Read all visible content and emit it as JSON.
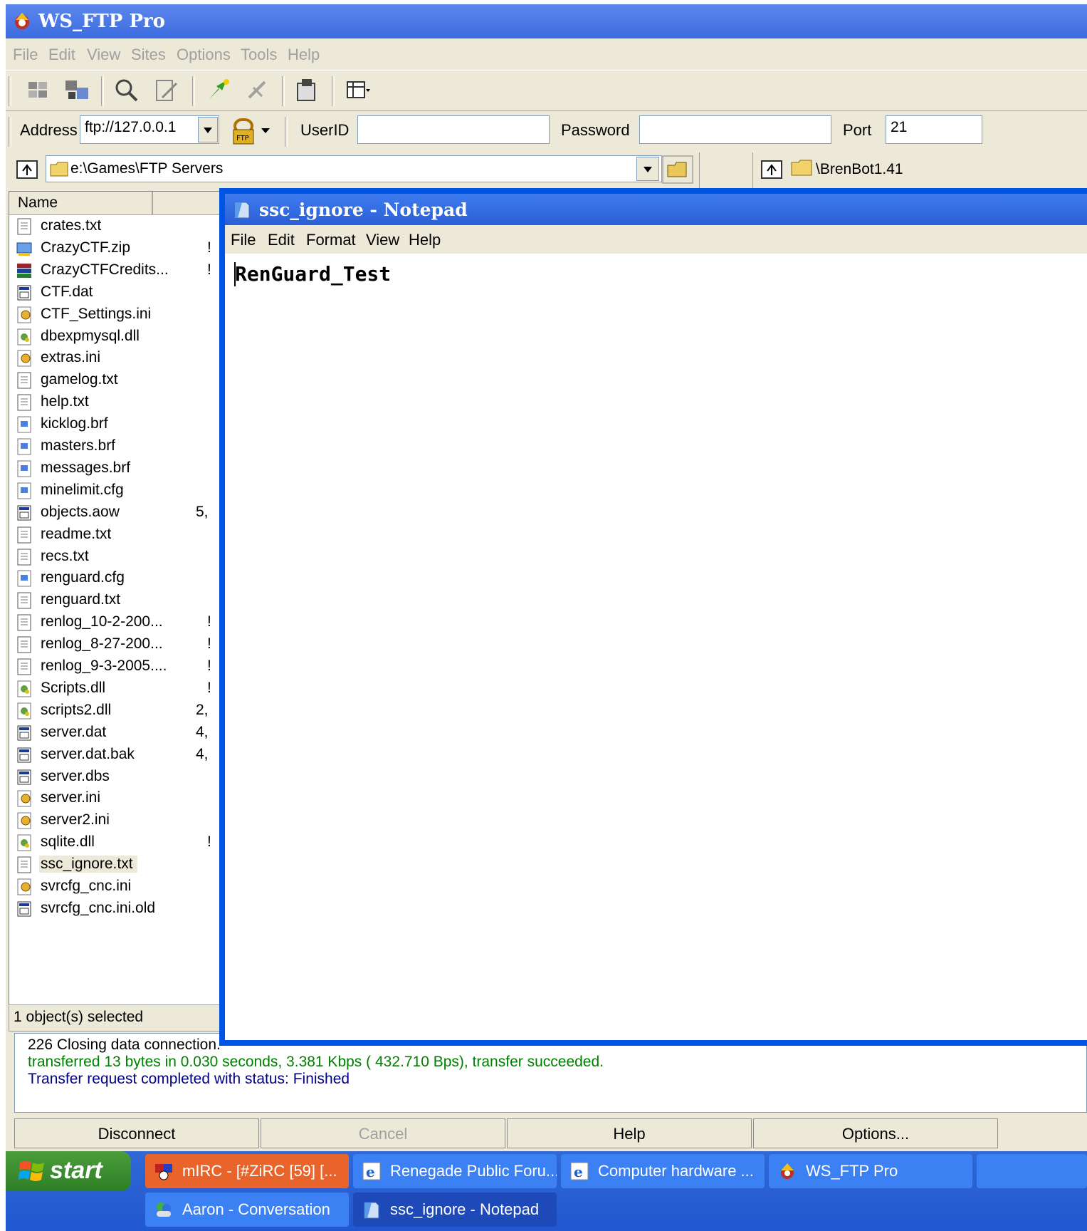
{
  "app": {
    "title": "WS_FTP Pro"
  },
  "menubar": [
    "File",
    "Edit",
    "View",
    "Sites",
    "Options",
    "Tools",
    "Help"
  ],
  "address": {
    "address_label": "Address",
    "address_value": "ftp://127.0.0.1",
    "userid_label": "UserID",
    "userid_value": "",
    "password_label": "Password",
    "password_value": "",
    "port_label": "Port",
    "port_value": "21"
  },
  "local_path": "e:\\Games\\FTP Servers",
  "remote_path": "\\BrenBot1.41",
  "file_list": {
    "column_name": "Name",
    "files": [
      {
        "name": "crates.txt",
        "type": "txt",
        "size": ""
      },
      {
        "name": "CrazyCTF.zip",
        "type": "zip",
        "size": "!"
      },
      {
        "name": "CrazyCTFCredits...",
        "type": "rar",
        "size": "!"
      },
      {
        "name": "CTF.dat",
        "type": "dat",
        "size": ""
      },
      {
        "name": "CTF_Settings.ini",
        "type": "ini",
        "size": ""
      },
      {
        "name": "dbexpmysql.dll",
        "type": "dll",
        "size": ""
      },
      {
        "name": "extras.ini",
        "type": "ini",
        "size": ""
      },
      {
        "name": "gamelog.txt",
        "type": "txt",
        "size": ""
      },
      {
        "name": "help.txt",
        "type": "txt",
        "size": ""
      },
      {
        "name": "kicklog.brf",
        "type": "brf",
        "size": ""
      },
      {
        "name": "masters.brf",
        "type": "brf",
        "size": ""
      },
      {
        "name": "messages.brf",
        "type": "brf",
        "size": ""
      },
      {
        "name": "minelimit.cfg",
        "type": "brf",
        "size": ""
      },
      {
        "name": "objects.aow",
        "type": "dat",
        "size": "5,"
      },
      {
        "name": "readme.txt",
        "type": "txt",
        "size": ""
      },
      {
        "name": "recs.txt",
        "type": "txt",
        "size": ""
      },
      {
        "name": "renguard.cfg",
        "type": "brf",
        "size": ""
      },
      {
        "name": "renguard.txt",
        "type": "txt",
        "size": ""
      },
      {
        "name": "renlog_10-2-200...",
        "type": "txt",
        "size": "!"
      },
      {
        "name": "renlog_8-27-200...",
        "type": "txt",
        "size": "!"
      },
      {
        "name": "renlog_9-3-2005....",
        "type": "txt",
        "size": "!"
      },
      {
        "name": "Scripts.dll",
        "type": "dll",
        "size": "!"
      },
      {
        "name": "scripts2.dll",
        "type": "dll",
        "size": "2,"
      },
      {
        "name": "server.dat",
        "type": "dat",
        "size": "4,"
      },
      {
        "name": "server.dat.bak",
        "type": "dat",
        "size": "4,"
      },
      {
        "name": "server.dbs",
        "type": "dat",
        "size": ""
      },
      {
        "name": "server.ini",
        "type": "ini",
        "size": ""
      },
      {
        "name": "server2.ini",
        "type": "ini",
        "size": ""
      },
      {
        "name": "sqlite.dll",
        "type": "dll",
        "size": "!"
      },
      {
        "name": "ssc_ignore.txt",
        "type": "txt",
        "size": ""
      },
      {
        "name": "svrcfg_cnc.ini",
        "type": "ini",
        "size": ""
      },
      {
        "name": "svrcfg_cnc.ini.old",
        "type": "dat",
        "size": ""
      }
    ],
    "selected": "ssc_ignore.txt"
  },
  "status": "1 object(s) selected",
  "log": [
    {
      "text": "226 Closing data connection.",
      "color": "#000000"
    },
    {
      "text": "transferred 13 bytes in 0.030 seconds, 3.381 Kbps ( 432.710 Bps), transfer succeeded.",
      "color": "#008000"
    },
    {
      "text": "Transfer request completed with status: Finished",
      "color": "#000080"
    }
  ],
  "buttons": {
    "disconnect": "Disconnect",
    "cancel": "Cancel",
    "help": "Help",
    "options": "Options..."
  },
  "notepad": {
    "title": "ssc_ignore - Notepad",
    "menu": [
      "File",
      "Edit",
      "Format",
      "View",
      "Help"
    ],
    "content": "RenGuard_Test"
  },
  "taskbar": {
    "start_label": "start",
    "tasks": [
      {
        "label": "mIRC - [#ZiRC [59] [...",
        "icon": "mirc-icon",
        "active": true
      },
      {
        "label": "Renegade Public Foru...",
        "icon": "ie-icon",
        "active": false
      },
      {
        "label": "Computer hardware ...",
        "icon": "ie-icon",
        "active": false
      },
      {
        "label": "WS_FTP Pro",
        "icon": "wsftp-icon",
        "active": false
      },
      {
        "label": "Aaron - Conversation",
        "icon": "msn-icon",
        "active": false
      },
      {
        "label": "ssc_ignore - Notepad",
        "icon": "notepad-icon",
        "active": true
      }
    ]
  },
  "colors": {
    "titlebar": "#3b6bde",
    "window_face": "#ece9d8",
    "taskbar": "#2157d0",
    "start_button": "#3c8f30",
    "selection": "#ece9d8"
  }
}
